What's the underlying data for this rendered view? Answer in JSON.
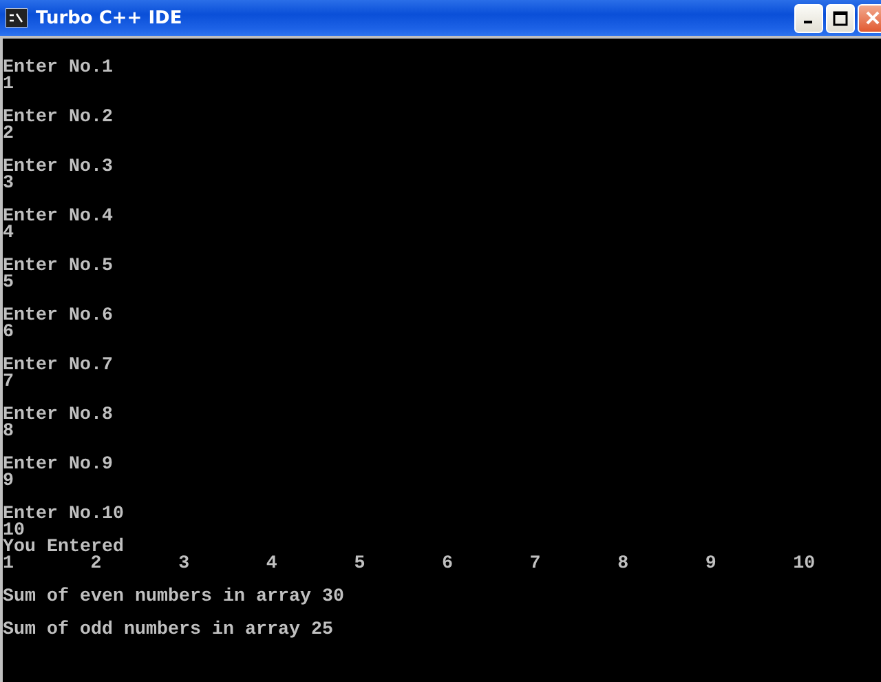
{
  "window": {
    "title": "Turbo C++ IDE"
  },
  "console": {
    "prompts": [
      {
        "prompt": "Enter No.1",
        "input": "1"
      },
      {
        "prompt": "Enter No.2",
        "input": "2"
      },
      {
        "prompt": "Enter No.3",
        "input": "3"
      },
      {
        "prompt": "Enter No.4",
        "input": "4"
      },
      {
        "prompt": "Enter No.5",
        "input": "5"
      },
      {
        "prompt": "Enter No.6",
        "input": "6"
      },
      {
        "prompt": "Enter No.7",
        "input": "7"
      },
      {
        "prompt": "Enter No.8",
        "input": "8"
      },
      {
        "prompt": "Enter No.9",
        "input": "9"
      },
      {
        "prompt": "Enter No.10",
        "input": "10"
      }
    ],
    "entered_heading": "You Entered",
    "entered_values": [
      "1",
      "2",
      "3",
      "4",
      "5",
      "6",
      "7",
      "8",
      "9",
      "10"
    ],
    "results": [
      "Sum of even numbers in array 30",
      "Sum of odd numbers in array 25"
    ]
  }
}
